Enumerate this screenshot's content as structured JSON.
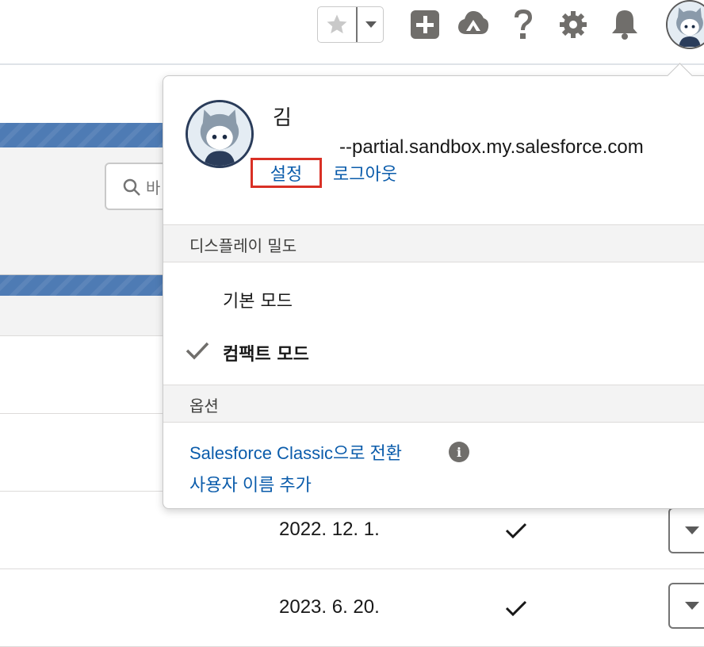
{
  "header": {
    "favorite_icon": "star-icon",
    "favorite_menu_icon": "chevron-down-icon",
    "icons": [
      "plus-icon",
      "trailhead-icon",
      "help-icon",
      "gear-icon",
      "bell-icon",
      "avatar"
    ]
  },
  "background_page": {
    "search_placeholder": "바",
    "rows": [
      {
        "date": "2022. 12. 1.",
        "checked": true
      },
      {
        "date": "2023. 6. 20.",
        "checked": true
      }
    ]
  },
  "user_menu": {
    "name": "김",
    "domain": "--partial.sandbox.my.salesforce.com",
    "settings_label": "설정",
    "logout_label": "로그아웃",
    "display_density": {
      "heading": "디스플레이 밀도",
      "options": [
        {
          "label": "기본 모드",
          "selected": false
        },
        {
          "label": "컴팩트 모드",
          "selected": true
        }
      ]
    },
    "options": {
      "heading": "옵션",
      "switch_classic_label": "Salesforce Classic으로 전환",
      "add_username_label": "사용자 이름 추가"
    }
  },
  "colors": {
    "link": "#0b5cab",
    "highlight_box": "#d93025",
    "banner": "#4e7bb4"
  }
}
